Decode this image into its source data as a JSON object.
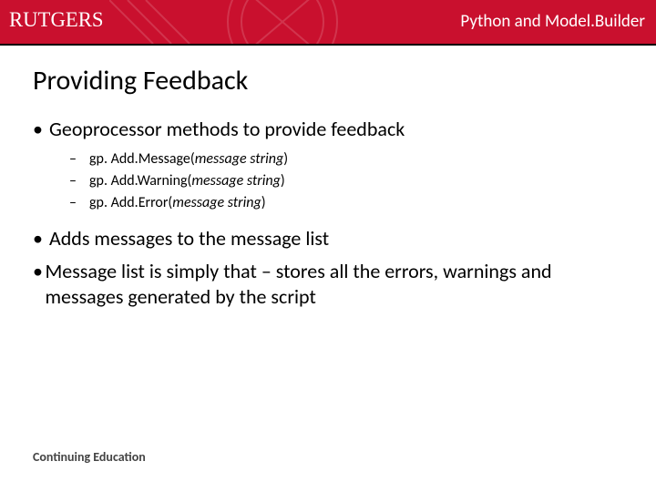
{
  "header": {
    "brand": "RUTGERS",
    "right": "Python and Model.Builder"
  },
  "title": "Providing Feedback",
  "bullets": [
    {
      "type": "l1",
      "text": "Geoprocessor methods to provide feedback"
    },
    {
      "type": "sub",
      "prefix": "gp. Add.Message(",
      "arg": "message string",
      "suffix": ")"
    },
    {
      "type": "sub",
      "prefix": "gp. Add.Warning(",
      "arg": "message string",
      "suffix": ")"
    },
    {
      "type": "sub",
      "prefix": "gp. Add.Error(",
      "arg": "message string",
      "suffix": ")"
    },
    {
      "type": "gap"
    },
    {
      "type": "l1",
      "text": "Adds messages to the message list"
    },
    {
      "type": "l1",
      "text": "Message list is simply that – stores all the errors, warnings and messages generated by the script"
    }
  ],
  "footer": "Continuing Education"
}
